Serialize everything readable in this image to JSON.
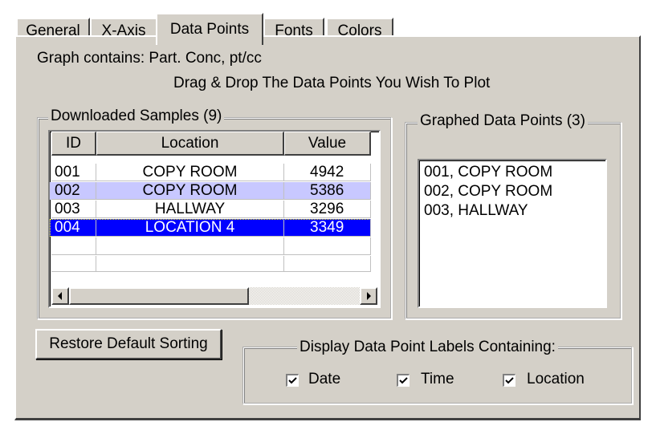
{
  "tabs": [
    "General",
    "X-Axis",
    "Data Points",
    "Fonts",
    "Colors"
  ],
  "active_tab": "Data Points",
  "graph_contains": "Graph contains: Part. Conc, pt/cc",
  "instruction": "Drag & Drop The Data Points You Wish To Plot",
  "downloaded": {
    "title": "Downloaded Samples (9)",
    "columns": [
      "ID",
      "Location",
      "Value"
    ],
    "rows": [
      {
        "id": "001",
        "location": "COPY ROOM",
        "value": "4942"
      },
      {
        "id": "002",
        "location": "COPY ROOM",
        "value": "5386"
      },
      {
        "id": "003",
        "location": "HALLWAY",
        "value": "3296"
      },
      {
        "id": "004",
        "location": "LOCATION 4",
        "value": "3349"
      }
    ]
  },
  "graphed": {
    "title": "Graphed Data Points (3)",
    "items": [
      "001, COPY ROOM",
      "002, COPY ROOM",
      "003, HALLWAY"
    ]
  },
  "restore_button": "Restore Default Sorting",
  "labels_group": {
    "title": "Display Data Point Labels Containing:",
    "options": [
      {
        "label": "Date",
        "checked": true
      },
      {
        "label": "Time",
        "checked": true
      },
      {
        "label": "Location",
        "checked": true
      }
    ]
  },
  "colors": {
    "selected_row": "#0000ff",
    "highlight_row": "#c8c8ff",
    "face": "#d4d0c8"
  }
}
